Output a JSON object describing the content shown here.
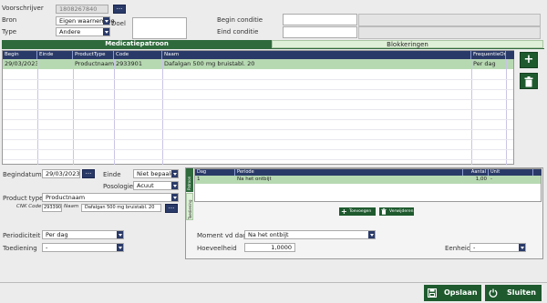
{
  "header": {
    "voorschrijver_label": "Voorschrijver",
    "voorschrijver_value": "1808267840",
    "bron_label": "Bron",
    "bron_value": "Eigen waarneming",
    "type_label": "Type",
    "type_value": "Andere",
    "doel_label": "Doel",
    "begin_conditie_label": "Begin conditie",
    "eind_conditie_label": "Eind conditie",
    "dots": "..."
  },
  "tabs": [
    {
      "label": "Medicatiepatroon"
    },
    {
      "label": "Blokkeringen"
    }
  ],
  "main_grid": {
    "columns": [
      "Begin",
      "Einde",
      "ProductType",
      "Code",
      "Naam",
      "FrequentieOm"
    ],
    "rows": [
      {
        "begin": "29/03/2023",
        "einde": "",
        "producttype": "Productnaam",
        "code": "2933901",
        "naam": "Dafalgan 500 mg bruistabl. 20",
        "frequentie": "Per dag"
      }
    ]
  },
  "side_buttons": {
    "add": "+",
    "delete": "delete"
  },
  "details": {
    "begindatum_label": "Begindatum",
    "begindatum_value": "29/03/2023",
    "einde_label": "Einde",
    "einde_value": "Niet bepaald",
    "posologie_label": "Posologie",
    "posologie_value": "Acuut",
    "product_type_label": "Product type",
    "product_type_value": "Productnaam",
    "cnk_label": "CNK Code",
    "cnk_value": "2933901",
    "naam_label": "Naam",
    "naam_value": "Dafalgan 500 mg bruistabl. 20",
    "periodiciteit_label": "Periodiciteit",
    "periodiciteit_value": "Per dag",
    "toediening_label": "Toediening",
    "toediening_value": "-"
  },
  "vtabs": [
    {
      "label": "Patroon"
    },
    {
      "label": "Toediening"
    }
  ],
  "pattern_grid": {
    "columns": [
      "Dag",
      "Periode",
      "Aantal",
      "Unit"
    ],
    "rows": [
      {
        "dag": "1",
        "periode": "Na het ontbijt",
        "aantal": "1,00",
        "unit": "-"
      }
    ]
  },
  "pattern_buttons": {
    "add": "Toevoegen",
    "remove": "Verwijderen"
  },
  "moment": {
    "moment_label": "Moment vd dag",
    "moment_value": "Na het ontbijt",
    "hoeveelheid_label": "Hoeveelheid",
    "hoeveelheid_value": "1,0000",
    "eenheid_label": "Eenheid",
    "eenheid_value": "-"
  },
  "footer": {
    "save_label": "Opslaan",
    "close_label": "Sluiten"
  },
  "colors": {
    "accent_green": "#2f6a3c",
    "header_navy": "#2a3a68",
    "selected_row": "#b7d9b2"
  }
}
